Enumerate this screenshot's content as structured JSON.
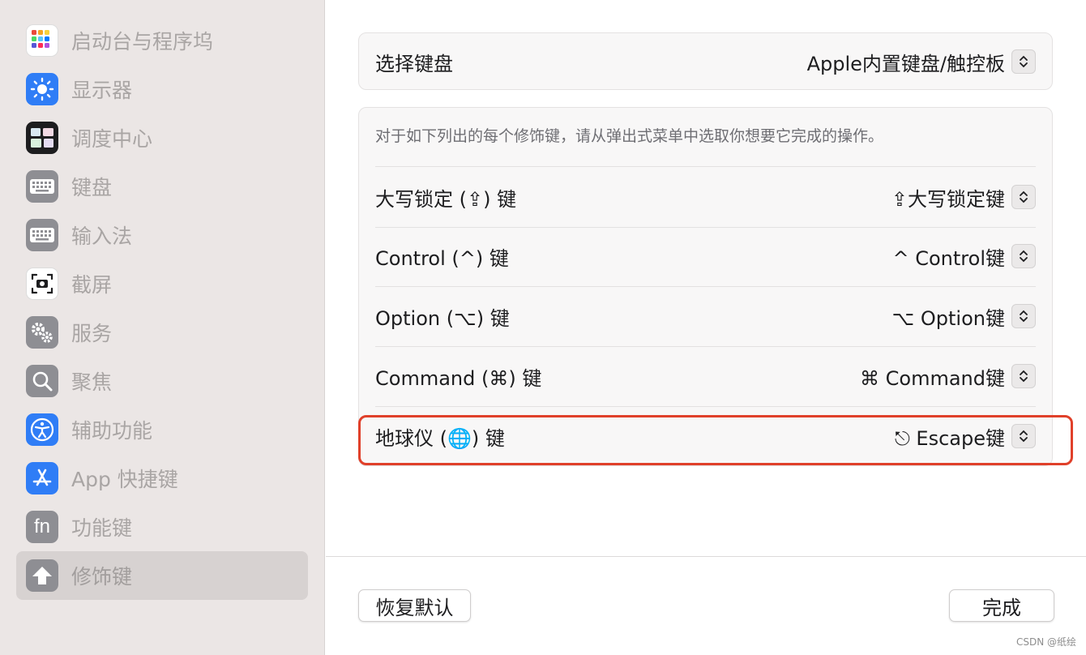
{
  "sidebar": {
    "items": [
      {
        "label": "启动台与程序坞",
        "icon": "launchpad-icon"
      },
      {
        "label": "显示器",
        "icon": "display-sun-icon"
      },
      {
        "label": "调度中心",
        "icon": "mission-control-icon"
      },
      {
        "label": "键盘",
        "icon": "keyboard-icon"
      },
      {
        "label": "输入法",
        "icon": "input-method-keyboard-icon"
      },
      {
        "label": "截屏",
        "icon": "screenshot-camera-icon"
      },
      {
        "label": "服务",
        "icon": "services-gears-icon"
      },
      {
        "label": "聚焦",
        "icon": "spotlight-magnifier-icon"
      },
      {
        "label": "辅助功能",
        "icon": "accessibility-icon"
      },
      {
        "label": "App 快捷键",
        "icon": "app-store-icon"
      },
      {
        "label": "功能键",
        "icon": "fn-key-icon",
        "glyph": "fn"
      },
      {
        "label": "修饰键",
        "icon": "modifier-arrow-icon",
        "selected": true
      }
    ]
  },
  "keyboard_select": {
    "label": "选择键盘",
    "value": "Apple内置键盘/触控板"
  },
  "modifiers": {
    "description": "对于如下列出的每个修饰键，请从弹出式菜单中选取你想要它完成的操作。",
    "rows": [
      {
        "label": "大写锁定 (⇪) 键",
        "value": "⇪大写锁定键"
      },
      {
        "label": "Control (^) 键",
        "value": "^ Control键"
      },
      {
        "label": "Option (⌥) 键",
        "value": "⌥ Option键"
      },
      {
        "label": "Command (⌘) 键",
        "value": "⌘ Command键"
      },
      {
        "label": "地球仪 (🌐) 键",
        "value": "⎋ Escape键"
      }
    ]
  },
  "footer": {
    "restore_label": "恢复默认",
    "done_label": "完成"
  },
  "watermark": "CSDN @纸绘",
  "colors": {
    "highlight": "#e0402a",
    "sidebar_bg": "#ebe6e5",
    "accent_blue": "#2f7df6"
  }
}
